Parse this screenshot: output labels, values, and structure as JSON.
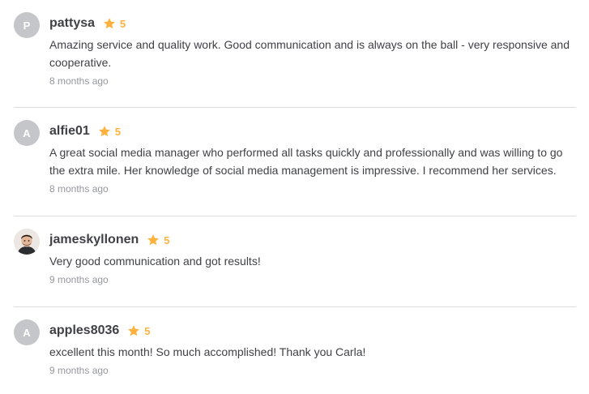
{
  "reviews": [
    {
      "avatar_initial": "P",
      "username": "pattysa",
      "rating": "5",
      "text": "Amazing service and quality work. Good communication and is always on the ball - very responsive and cooperative.",
      "time": "8 months ago"
    },
    {
      "avatar_initial": "A",
      "username": "alfie01",
      "rating": "5",
      "text": "A great social media manager who performed all tasks quickly and professionally and was willing to go the extra mile. Her knowledge of social media management is impressive. I recommend her services.",
      "time": "8 months ago"
    },
    {
      "avatar_initial": "",
      "username": "jameskyllonen",
      "rating": "5",
      "text": "Very good communication and got results!",
      "time": "9 months ago"
    },
    {
      "avatar_initial": "A",
      "username": "apples8036",
      "rating": "5",
      "text": "excellent this month! So much accomplished! Thank you Carla!",
      "time": "9 months ago"
    }
  ],
  "colors": {
    "star": "#ffb33e",
    "avatar_bg": "#c5c6c9",
    "divider": "#dadbdd",
    "muted_text": "#95979d"
  }
}
